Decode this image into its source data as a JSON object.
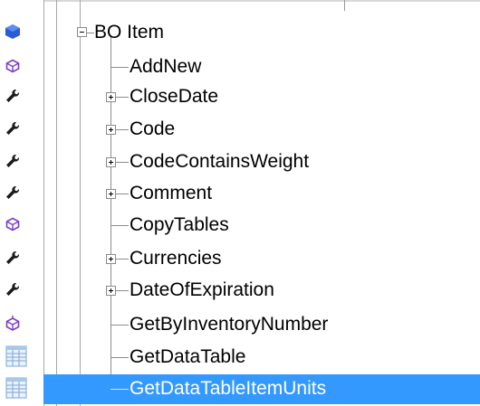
{
  "tree": {
    "root": {
      "label": "BO  Item",
      "icon": "blue-cube-icon",
      "expanded": true
    },
    "children": [
      {
        "label": "AddNew",
        "icon": "method-cube-icon",
        "expandable": false
      },
      {
        "label": "CloseDate",
        "icon": "wrench-icon",
        "expandable": true
      },
      {
        "label": "Code",
        "icon": "wrench-icon",
        "expandable": true
      },
      {
        "label": "CodeContainsWeight",
        "icon": "wrench-icon",
        "expandable": true
      },
      {
        "label": "Comment",
        "icon": "wrench-icon",
        "expandable": true
      },
      {
        "label": "CopyTables",
        "icon": "method-cube-icon",
        "expandable": false
      },
      {
        "label": "Currencies",
        "icon": "wrench-icon",
        "expandable": true
      },
      {
        "label": "DateOfExpiration",
        "icon": "wrench-icon",
        "expandable": true
      },
      {
        "label": "GetByInventoryNumber",
        "icon": "method-cube-icon",
        "expandable": false
      },
      {
        "label": "GetDataTable",
        "icon": "table-icon",
        "expandable": false
      },
      {
        "label": "GetDataTableItemUnits",
        "icon": "table-icon",
        "expandable": false,
        "selected": true
      }
    ]
  },
  "colors": {
    "selection": "#3399ff",
    "icon_purple": "#7a3dc8",
    "icon_blue": "#2a5bd7"
  }
}
